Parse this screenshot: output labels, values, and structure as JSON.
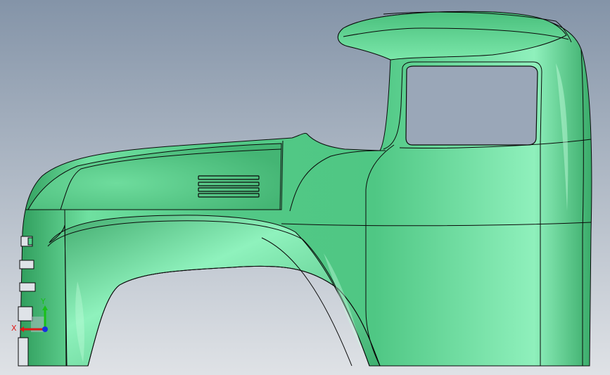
{
  "viewport": {
    "background_top": "#8494a8",
    "background_bottom": "#dfe2e6",
    "model_color": "#4fcf86",
    "edge_color": "#0a0a0a"
  },
  "triad": {
    "x_label": "X",
    "y_label": "Y",
    "x_color": "#e01818",
    "y_color": "#18c018",
    "z_color": "#1830e0"
  }
}
